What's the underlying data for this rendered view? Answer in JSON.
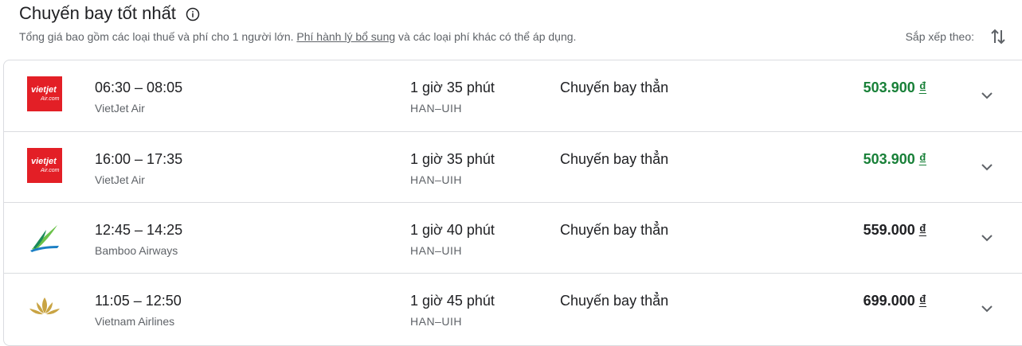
{
  "header": {
    "title": "Chuyến bay tốt nhất",
    "subtitle_before": "Tổng giá bao gồm các loại thuế và phí cho 1 người lớn. ",
    "subtitle_link": "Phí hành lý bổ sung",
    "subtitle_after": " và các loại phí khác có thể áp dụng.",
    "sort_label": "Sắp xếp theo:"
  },
  "colors": {
    "price_best": "#188038",
    "vietjet_red": "#e31f26",
    "vietnam_airlines_gold": "#c9a444",
    "bamboo_green": "#6cc24a"
  },
  "flights": [
    {
      "logo": "vietjet-logo",
      "logo_text": "vietjet",
      "times": "06:30 – 08:05",
      "airline": "VietJet Air",
      "duration": "1 giờ 35 phút",
      "route": "HAN–UIH",
      "stops": "Chuyến bay thẳn",
      "price": "503.900",
      "currency": "₫"
    },
    {
      "logo": "vietjet-logo",
      "logo_text": "vietjet",
      "times": "16:00 – 17:35",
      "airline": "VietJet Air",
      "duration": "1 giờ 35 phút",
      "route": "HAN–UIH",
      "stops": "Chuyến bay thẳn",
      "price": "503.900",
      "currency": "₫"
    },
    {
      "logo": "bamboo-logo",
      "times": "12:45 – 14:25",
      "airline": "Bamboo Airways",
      "duration": "1 giờ 40 phút",
      "route": "HAN–UIH",
      "stops": "Chuyến bay thẳn",
      "price": "559.000",
      "currency": "₫"
    },
    {
      "logo": "vietnam-airlines-logo",
      "times": "11:05 – 12:50",
      "airline": "Vietnam Airlines",
      "duration": "1 giờ 45 phút",
      "route": "HAN–UIH",
      "stops": "Chuyến bay thẳn",
      "price": "699.000",
      "currency": "₫"
    }
  ]
}
